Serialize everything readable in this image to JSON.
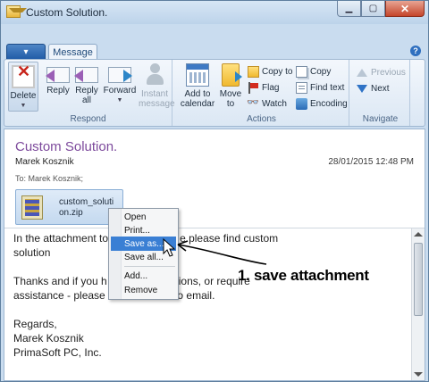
{
  "window": {
    "title": "Custom Solution."
  },
  "ribbon": {
    "file_menu_label": "▾",
    "tab_message": "Message",
    "groups": {
      "respond": {
        "label": "Respond",
        "delete": "Delete",
        "reply": "Reply",
        "reply_all": "Reply all",
        "forward": "Forward",
        "instant_message": "Instant message"
      },
      "actions": {
        "label": "Actions",
        "add_to_calendar": "Add to calendar",
        "move_to": "Move to",
        "copy_to": "Copy to",
        "flag": "Flag",
        "watch": "Watch",
        "copy": "Copy",
        "find_text": "Find text",
        "encoding": "Encoding"
      },
      "navigate": {
        "label": "Navigate",
        "previous": "Previous",
        "next": "Next"
      }
    }
  },
  "message": {
    "subject": "Custom Solution.",
    "sender": "Marek Kosznik",
    "date": "28/01/2015 12:48 PM",
    "to_label": "To:",
    "to_value": "Marek Kosznik;",
    "attachment": {
      "name_line1": "custom_soluti",
      "name_line2": "on.zip",
      "icon": "zip-archive-icon"
    },
    "body": {
      "line1": "In the attachment to",
      "line1b": "e please find custom",
      "line2": "solution",
      "line3": "Thanks and if you h",
      "line3b": "ions, or require",
      "line4": "assistance - please c",
      "line4b": "to email.",
      "line5": "Regards,",
      "line6": "Marek Kosznik",
      "line7": "PrimaSoft PC, Inc."
    }
  },
  "context_menu": {
    "items": [
      "Open",
      "Print...",
      "Save as...",
      "Save all...",
      "Add...",
      "Remove"
    ],
    "highlighted": "Save as..."
  },
  "annotation": {
    "text": "1. save attachment"
  },
  "colors": {
    "accent": "#3a7fd4",
    "subject": "#7d4a9c",
    "ribbon_bg": "#dbe7f4"
  }
}
